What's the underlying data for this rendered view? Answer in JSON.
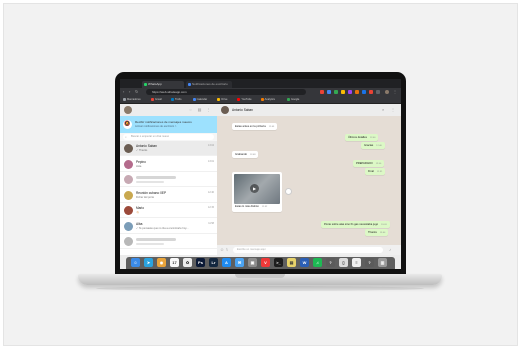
{
  "browser": {
    "tabs": [
      {
        "label": "WhatsApp",
        "color": "#25d366"
      },
      {
        "label": "Notificaciones de escritorio",
        "color": "#4285f4"
      }
    ],
    "url": "https://web.whatsapp.com",
    "bookmarks": [
      {
        "label": "Marcadores",
        "color": "#9aa0a6"
      },
      {
        "label": "Gmail",
        "color": "#ea4335"
      },
      {
        "label": "Trello",
        "color": "#0079bf"
      },
      {
        "label": "Calendar",
        "color": "#4285f4"
      },
      {
        "label": "Drive",
        "color": "#fbbc05"
      },
      {
        "label": "YouTube",
        "color": "#ff0000"
      },
      {
        "label": "Analytics",
        "color": "#f57c00"
      },
      {
        "label": "Google",
        "color": "#34a853"
      }
    ]
  },
  "sidebar": {
    "notification": {
      "title": "Recibir notificaciones de mensajes nuevos",
      "link": "Activar notificaciones de escritorio >"
    },
    "search_placeholder": "Buscar o empezar un chat nuevo",
    "chats": [
      {
        "name": "Antonio Saban",
        "message": "✓ Thanks",
        "time": "13:04",
        "avatar": "#6b5d52",
        "selected": true
      },
      {
        "name": "Pepino",
        "message": "Hola",
        "time": "13:01",
        "avatar": "#b46b8c",
        "selected": false
      },
      {
        "name": "",
        "message": "",
        "time": "",
        "avatar": "#c7a9b3",
        "selected": false,
        "blurred": true
      },
      {
        "name": "Reunión cubano 0EP",
        "message": "Fichar del porte",
        "time": "12:40",
        "avatar": "#c9a84f",
        "selected": false
      },
      {
        "name": "Mario",
        "message": "👋🏻",
        "time": "12:15",
        "avatar": "#9c4a3a",
        "selected": false
      },
      {
        "name": "Alba",
        "message": "✓ Te pensaste que no iba a encontrarte hoy...",
        "time": "11:58",
        "avatar": "#7b9db8",
        "selected": false
      },
      {
        "name": "",
        "message": "",
        "time": "",
        "avatar": "#b8b8b8",
        "selected": false,
        "blurred": true
      }
    ]
  },
  "conversation": {
    "contact": "Antonio Saban",
    "messages": [
      {
        "text": "Estas antes en la pizzería",
        "time": "12:45",
        "dir": "in"
      },
      {
        "text": "Últimos detalles",
        "time": "12:46",
        "dir": "out"
      },
      {
        "text": "Gracias",
        "time": "12:46",
        "dir": "out"
      },
      {
        "text": "Grabando",
        "time": "12:48",
        "dir": "in"
      },
      {
        "text": "PREPARADO",
        "time": "12:50",
        "dir": "out"
      },
      {
        "text": "Final",
        "time": "12:51",
        "dir": "out"
      },
      {
        "text": "Estas lo más distinto",
        "time": "12:52",
        "dir": "in",
        "media": true
      },
      {
        "text": "Ponte sobre alas sino fin gas necesitaba jugo",
        "time": "13:03",
        "dir": "out"
      },
      {
        "text": "Thanks",
        "time": "13:04",
        "dir": "out"
      }
    ],
    "composer_placeholder": "Escribe un mensaje aquí"
  },
  "dock": [
    {
      "name": "finder",
      "label": "☺",
      "color": "#3b8be8"
    },
    {
      "name": "telegram",
      "label": "➤",
      "color": "#2aa3df"
    },
    {
      "name": "chrome",
      "label": "◉",
      "color": "#e9a43b"
    },
    {
      "name": "calendar",
      "label": "17",
      "color": "#fafafa"
    },
    {
      "name": "photos",
      "label": "✿",
      "color": "#ededed"
    },
    {
      "name": "photoshop",
      "label": "Ps",
      "color": "#0c1a36"
    },
    {
      "name": "lightroom",
      "label": "Lr",
      "color": "#14283f"
    },
    {
      "name": "app-store",
      "label": "A",
      "color": "#1f8bf0"
    },
    {
      "name": "mail",
      "label": "✉",
      "color": "#4aa3f2"
    },
    {
      "name": "preview",
      "label": "▣",
      "color": "#8d8d8d"
    },
    {
      "name": "vivaldi",
      "label": "V",
      "color": "#ef3939"
    },
    {
      "name": "terminal",
      "label": ">_",
      "color": "#1d1d1d"
    },
    {
      "name": "notes",
      "label": "▤",
      "color": "#e8d36a"
    },
    {
      "name": "word",
      "label": "W",
      "color": "#2b5fb5"
    },
    {
      "name": "spotify",
      "label": "♫",
      "color": "#1db954"
    },
    {
      "name": "help",
      "label": "?",
      "color": "#5b5b5b"
    },
    {
      "name": "document",
      "label": "▯",
      "color": "#dcdcdc"
    },
    {
      "name": "pages",
      "label": "≡",
      "color": "#f0f0f0"
    },
    {
      "name": "help-2",
      "label": "?",
      "color": "#5b5b5b"
    },
    {
      "name": "trash",
      "label": "▥",
      "color": "#9a9a9a"
    }
  ]
}
